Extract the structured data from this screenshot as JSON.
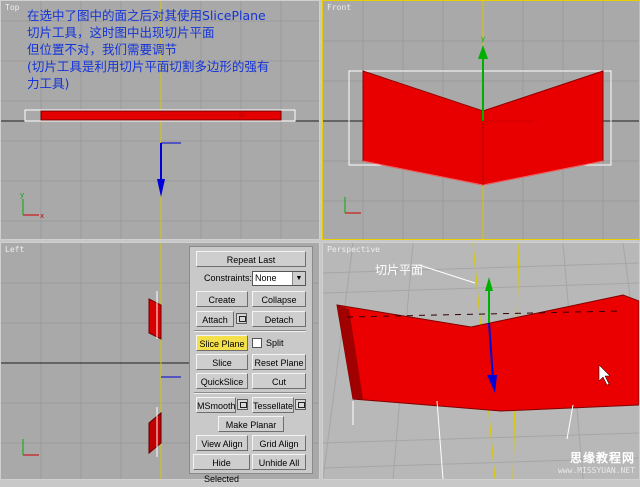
{
  "viewports": {
    "top": {
      "label": "Top"
    },
    "front": {
      "label": "Front"
    },
    "left": {
      "label": "Left"
    },
    "perspective": {
      "label": "Perspective"
    }
  },
  "annotation": {
    "line1": "在选中了图中的面之后对其使用SlicePlane",
    "line2": "切片工具，这时图中出现切片平面",
    "line3": "但位置不对，我们需要调节",
    "line4": "(切片工具是利用切片平面切割多边形的强有",
    "line5": "力工具)"
  },
  "perspective_note": "切片平面",
  "watermark": {
    "site_cn": "思缘教程网",
    "site_url": "www.MISSYUAN.NET"
  },
  "panel": {
    "repeat_last": "Repeat Last",
    "constraints_label": "Constraints:",
    "constraints_value": "None",
    "create": "Create",
    "collapse": "Collapse",
    "attach": "Attach",
    "detach": "Detach",
    "slice_plane": "Slice Plane",
    "split": "Split",
    "slice": "Slice",
    "reset_plane": "Reset Plane",
    "quickslice": "QuickSlice",
    "cut": "Cut",
    "msmooth": "MSmooth",
    "tessellate": "Tessellate",
    "make_planar": "Make Planar",
    "view_align": "View Align",
    "grid_align": "Grid Align",
    "hide_selected": "Hide Selected",
    "unhide_all": "Unhide All"
  },
  "colors": {
    "object": "#e80000",
    "active_border": "#e8d000",
    "annotation": "#1433d8",
    "panel_active": "#f3e04a"
  }
}
